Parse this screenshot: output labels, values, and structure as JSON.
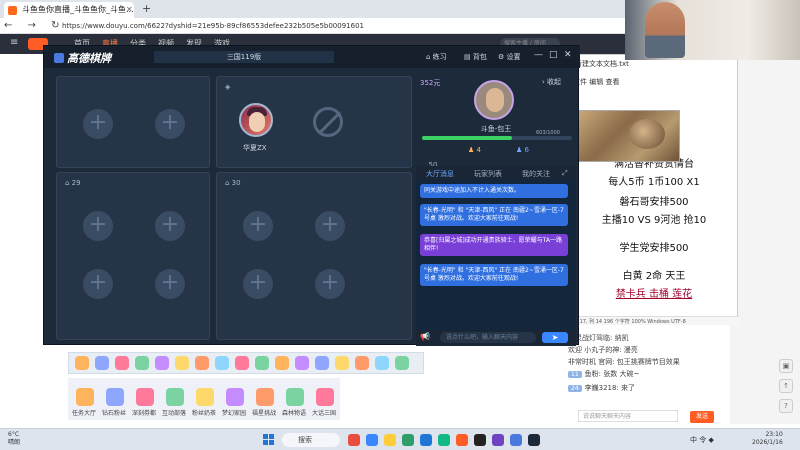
{
  "browser": {
    "tab_title": "斗鱼鱼你直播_斗鱼鱼你_斗鱼...",
    "tab_close": "✕",
    "new_tab": "+",
    "nav": "← → ↻",
    "url": "https://www.douyu.com/6622?dyshid=21e95b-89cf86553defee232b505e5b00091601"
  },
  "site_header": {
    "menu_icon": "≡",
    "nav": [
      "首页",
      "直播",
      "分类",
      "视频",
      "发现",
      "游戏",
      "鱼吧"
    ],
    "search_placeholder": "搜索主播 / 房间"
  },
  "game_window": {
    "logo": "高德棋牌",
    "room": "三国119版",
    "toolbar": [
      "练习",
      "背包",
      "设置"
    ],
    "controls": [
      "—",
      "□",
      "✕"
    ],
    "tables": [
      {
        "id": "",
        "seats": [
          "empty",
          "empty"
        ]
      },
      {
        "id": "",
        "seats": [
          "player",
          "banned"
        ],
        "player_name": "华夏ZX"
      },
      {
        "id": "29",
        "seats": [
          "empty",
          "empty",
          "empty",
          "empty"
        ]
      },
      {
        "id": "30",
        "seats": [
          "empty",
          "empty",
          "empty",
          "empty"
        ]
      }
    ],
    "scroll_ticks": [
      "1",
      "25",
      "50",
      "75",
      "100",
      "125",
      "150",
      "175",
      "200"
    ],
    "scroll_active": "125"
  },
  "right_panel": {
    "coins": "352元",
    "collapse": "› 收起",
    "player_name": "斗鱼-包王",
    "hp_text": "603/1000",
    "hp_fraction": 0.6,
    "stat_orange": "4",
    "stat_blue": "6",
    "tabs": [
      "大厅消息",
      "玩家列表",
      "我的关注"
    ],
    "messages": [
      {
        "text": "同关游戏中途加入不计入通关次数。",
        "style": "blue"
      },
      {
        "text": "\"长春-光明\" 和 \"天津-西风\" 正在 南疆2~雪涌一区-7号桌 激烈对战。欢迎大家前往观战!",
        "style": "blue"
      },
      {
        "text": "恭喜[归属之城]成功开通贵族骑士，愿荣耀与TA一路相伴!",
        "style": "purple"
      },
      {
        "text": "\"长春-光明\" 和 \"天津-西风\" 正在 南疆2~雪涌一区-7号桌 激烈对战。欢迎大家前往观战!",
        "style": "blue"
      }
    ],
    "input_placeholder": "说点什么吧，输入聊天内容",
    "send": "➤"
  },
  "notepad": {
    "title": "新建文本文档.txt",
    "menu": "文件 编辑 查看",
    "lines": [
      "满活替补赞赏情台",
      "每人5币 1币100  X1",
      "磐石哥安排500",
      "主播10    VS    9河池    抢10",
      "学生党安排500",
      "白黄 2命  天王",
      "禁卡兵 击桶 莲花"
    ],
    "status": "行 17, 列 14    196 个字符    100%    Windows    UTF-8"
  },
  "chat": {
    "lines": [
      {
        "level": "",
        "text": "幽灵战灯驾临: 纳凯"
      },
      {
        "level": "",
        "text": "欢迎 小丸子的神: 漫亮"
      },
      {
        "level": "",
        "text": "非常时机 官网: 包王挑赛牌节目效果"
      },
      {
        "level": "11",
        "text": "鱼粉: 张数 大碗~"
      },
      {
        "level": "24",
        "text": "李巍3218: 来了"
      }
    ],
    "input_placeholder": "说说聊天聊天内容",
    "send": "发送"
  },
  "gifts": {
    "labels": [
      "任务大厅",
      "钻石粉丝",
      "深刻券都",
      "互动部落",
      "粉丝奶茶",
      "梦幻家园",
      "福星挑战",
      "森林物语",
      "大话三国"
    ]
  },
  "taskbar": {
    "weather_temp": "6°C",
    "weather_desc": "晴朗",
    "search": "搜索",
    "tray": "中 令 ◆",
    "time": "23:10",
    "date": "2026/1/16"
  },
  "colors": {
    "game_bg": "#1d2a3a",
    "accent_blue": "#2f6fe0",
    "accent_purple": "#7a3fd6",
    "douyu_orange": "#ff5d23",
    "hp_green": "#3bd165"
  }
}
